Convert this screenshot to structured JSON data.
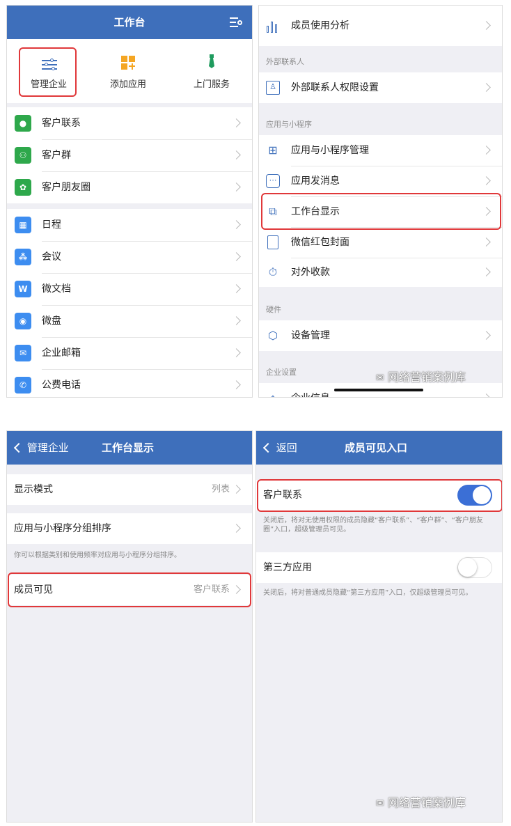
{
  "panel1": {
    "title": "工作台",
    "shortcuts": [
      {
        "label": "管理企业",
        "icon": "sliders-icon"
      },
      {
        "label": "添加应用",
        "icon": "add-apps-icon"
      },
      {
        "label": "上门服务",
        "icon": "tie-icon"
      }
    ],
    "group1": [
      {
        "label": "客户联系",
        "icon": "chat-bubble-icon",
        "color": "#2ea84b"
      },
      {
        "label": "客户群",
        "icon": "group-icon",
        "color": "#2ea84b"
      },
      {
        "label": "客户朋友圈",
        "icon": "moments-icon",
        "color": "#2ea84b"
      }
    ],
    "group2": [
      {
        "label": "日程",
        "icon": "calendar-icon",
        "color": "#3d8df0",
        "glyph": "▦"
      },
      {
        "label": "会议",
        "icon": "meeting-icon",
        "color": "#3d8df0",
        "glyph": "⁂"
      },
      {
        "label": "微文档",
        "icon": "doc-icon",
        "color": "#3d8df0",
        "glyph": "W"
      },
      {
        "label": "微盘",
        "icon": "disk-icon",
        "color": "#3d8df0",
        "glyph": "◉"
      },
      {
        "label": "企业邮箱",
        "icon": "mail-icon",
        "color": "#3d8df0",
        "glyph": "✉"
      },
      {
        "label": "公费电话",
        "icon": "phone-icon",
        "color": "#3d8df0",
        "glyph": "✆"
      }
    ]
  },
  "panel2": {
    "top_item": {
      "label": "成员使用分析",
      "icon": "bar-chart-icon"
    },
    "section_external": "外部联系人",
    "external_item": {
      "label": "外部联系人权限设置",
      "icon": "contact-card-icon"
    },
    "section_apps": "应用与小程序",
    "app_items": [
      {
        "label": "应用与小程序管理",
        "icon": "grid-icon",
        "glyph": "⊞"
      },
      {
        "label": "应用发消息",
        "icon": "message-icon",
        "glyph": "⋯"
      },
      {
        "label": "工作台显示",
        "icon": "workbench-icon",
        "glyph": "⧉"
      },
      {
        "label": "微信红包封面",
        "icon": "red-packet-icon",
        "glyph": "▭"
      },
      {
        "label": "对外收款",
        "icon": "payment-icon",
        "glyph": "⏱"
      }
    ],
    "section_hardware": "硬件",
    "hardware_item": {
      "label": "设备管理",
      "icon": "cube-icon"
    },
    "section_settings": "企业设置",
    "partial_item": "企业信息",
    "watermark": "网络营销案例库"
  },
  "panel3": {
    "back_label": "管理企业",
    "title": "工作台显示",
    "display_mode": {
      "label": "显示模式",
      "value": "列表"
    },
    "group_sort": {
      "label": "应用与小程序分组排序"
    },
    "hint": "你可以根据类别和使用频率对应用与小程序分组排序。",
    "member_visible": {
      "label": "成员可见",
      "value": "客户联系"
    }
  },
  "panel4": {
    "back_label": "返回",
    "title": "成员可见入口",
    "customer_contact": {
      "label": "客户联系",
      "on": true
    },
    "hint1": "关闭后，将对无使用权限的成员隐藏“客户联系”、“客户群”、“客户朋友圈”入口，超级管理员可见。",
    "third_party": {
      "label": "第三方应用",
      "on": false
    },
    "hint2": "关闭后，将对普通成员隐藏“第三方应用”入口，仅超级管理员可见。",
    "watermark": "网络营销案例库",
    "toggle_color": "#3b6fd6"
  }
}
